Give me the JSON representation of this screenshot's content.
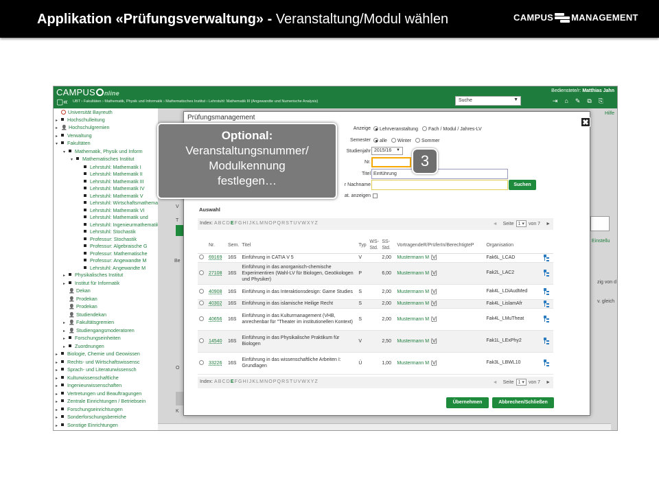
{
  "slide": {
    "title_bold": "Applikation «Prüfungsverwaltung» - ",
    "title_rest": "Veranstaltung/Modul wählen",
    "logo_text_1": "CAMPUS",
    "logo_text_2": "MANAGEMENT"
  },
  "app": {
    "logo_campus": "CAMPUS",
    "logo_online": "nline",
    "nav_icons": "▢«",
    "breadcrumb": "UBT  ›  Fakultäten  ›  Mathematik, Physik und Informatik  ›  Mathematisches Institut  ›  Lehrstuhl: Mathematik III (Angewandte und Numerische Analysis)",
    "user_label": "Bedienstete/r: ",
    "user_name": "Matthias Jahn",
    "search_select": "Suche",
    "toolbar_icons": "⇥⌂✎⧉⎘",
    "help": "Hilfe"
  },
  "tree": [
    {
      "indent": 0,
      "arrow": "",
      "kind": "uni",
      "label": "Universität Bayreuth"
    },
    {
      "indent": 0,
      "arrow": "▸",
      "kind": "sq",
      "label": "Hochschulleitung"
    },
    {
      "indent": 0,
      "arrow": "▸",
      "kind": "ppl",
      "label": "Hochschulgremien"
    },
    {
      "indent": 0,
      "arrow": "▸",
      "kind": "sq",
      "label": "Verwaltung"
    },
    {
      "indent": 0,
      "arrow": "▾",
      "kind": "sq",
      "label": "Fakultäten"
    },
    {
      "indent": 1,
      "arrow": "▾",
      "kind": "sq",
      "label": "Mathematik, Physik und Inform"
    },
    {
      "indent": 2,
      "arrow": "▾",
      "kind": "sq",
      "label": "Mathematisches Institut"
    },
    {
      "indent": 3,
      "arrow": "",
      "kind": "sq",
      "label": "Lehrstuhl: Mathematik I"
    },
    {
      "indent": 3,
      "arrow": "",
      "kind": "sq",
      "label": "Lehrstuhl: Mathematik II"
    },
    {
      "indent": 3,
      "arrow": "",
      "kind": "sq",
      "label": "Lehrstuhl: Mathematik III"
    },
    {
      "indent": 3,
      "arrow": "",
      "kind": "sq",
      "label": "Lehrstuhl: Mathematik IV"
    },
    {
      "indent": 3,
      "arrow": "",
      "kind": "sq",
      "label": "Lehrstuhl: Mathematik V"
    },
    {
      "indent": 3,
      "arrow": "",
      "kind": "sq",
      "label": "Lehrstuhl: Wirtschaftsmathematik"
    },
    {
      "indent": 3,
      "arrow": "",
      "kind": "sq",
      "label": "Lehrstuhl: Mathematik VI"
    },
    {
      "indent": 3,
      "arrow": "",
      "kind": "sq",
      "label": "Lehrstuhl: Mathematik und"
    },
    {
      "indent": 3,
      "arrow": "",
      "kind": "sq",
      "label": "Lehrstuhl: Ingenieurmathematik"
    },
    {
      "indent": 3,
      "arrow": "",
      "kind": "sq",
      "label": "Lehrstuhl: Stochastik"
    },
    {
      "indent": 3,
      "arrow": "",
      "kind": "sq",
      "label": "Professur: Stochastik"
    },
    {
      "indent": 3,
      "arrow": "",
      "kind": "sq",
      "label": "Professur: Algebraische G"
    },
    {
      "indent": 3,
      "arrow": "",
      "kind": "sq",
      "label": "Professur: Mathematische"
    },
    {
      "indent": 3,
      "arrow": "",
      "kind": "sq",
      "label": "Professur: Angewandte M"
    },
    {
      "indent": 3,
      "arrow": "",
      "kind": "sq",
      "label": "Lehrstuhl: Angewandte M"
    },
    {
      "indent": 1,
      "arrow": "▸",
      "kind": "sq",
      "label": "Physikalisches Institut"
    },
    {
      "indent": 1,
      "arrow": "▸",
      "kind": "sq",
      "label": "Institut für Informatik"
    },
    {
      "indent": 1,
      "arrow": "",
      "kind": "ppl",
      "label": "Dekan"
    },
    {
      "indent": 1,
      "arrow": "",
      "kind": "ppl",
      "label": "Prodekan"
    },
    {
      "indent": 1,
      "arrow": "",
      "kind": "ppl",
      "label": "Prodekan"
    },
    {
      "indent": 1,
      "arrow": "",
      "kind": "ppl",
      "label": "Studiendekan"
    },
    {
      "indent": 1,
      "arrow": "▸",
      "kind": "ppl",
      "label": "Fakultätsgremien"
    },
    {
      "indent": 1,
      "arrow": "▸",
      "kind": "ppl",
      "label": "Studiengangsmoderatoren"
    },
    {
      "indent": 1,
      "arrow": "▸",
      "kind": "sq",
      "label": "Forschungseinheiten"
    },
    {
      "indent": 1,
      "arrow": "▸",
      "kind": "sq",
      "label": "Zuordnungen"
    },
    {
      "indent": 0,
      "arrow": "▸",
      "kind": "sq",
      "label": "Biologie, Chemie und Geowissen"
    },
    {
      "indent": 0,
      "arrow": "▸",
      "kind": "sq",
      "label": "Rechts- und Wirtschaftswissensc"
    },
    {
      "indent": 0,
      "arrow": "▸",
      "kind": "sq",
      "label": "Sprach- und Literaturwissensch"
    },
    {
      "indent": 0,
      "arrow": "▸",
      "kind": "sq",
      "label": "Kulturwissenschaftliche"
    },
    {
      "indent": 0,
      "arrow": "▸",
      "kind": "sq",
      "label": "Ingenieurwissenschaften"
    },
    {
      "indent": 0,
      "arrow": "▸",
      "kind": "sq",
      "label": "Vertretungen und Beauftragungen"
    },
    {
      "indent": 0,
      "arrow": "▸",
      "kind": "sq",
      "label": "Zentrale Einrichtungen / Betriebsein"
    },
    {
      "indent": 0,
      "arrow": "▸",
      "kind": "sq",
      "label": "Forschungseinrichtungen"
    },
    {
      "indent": 0,
      "arrow": "▸",
      "kind": "sq",
      "label": "Sonderforschungsbereiche"
    },
    {
      "indent": 0,
      "arrow": "▸",
      "kind": "sq",
      "label": "Sonstige Einrichtungen"
    }
  ],
  "background": {
    "t1": "Einstellu",
    "t2": "zig von d",
    "t3": "v. gleich"
  },
  "modal": {
    "title": "Prüfungsmanagement",
    "close": "✖",
    "anzeige_label": "Anzeige",
    "anzeige_opt1": "Lehrveranstaltung",
    "anzeige_opt2": "Fach / Modul / Jahres-LV",
    "semester_label": "Semester",
    "semester_opt1": "alle",
    "semester_opt2": "Winter",
    "semester_opt3": "Sommer",
    "studienjahr_label": "Studienjahr",
    "studienjahr_value": "2015/16",
    "nr_label": "Nr.",
    "nr_value": "",
    "titel_label": "Titel",
    "titel_value": "Einführung",
    "nachname_label": "r Nachname",
    "nachname_value": "",
    "suchen": "Suchen",
    "stat_label": "at. anzeigen",
    "auswahl": "Auswahl",
    "index_label": "Index: ",
    "index_letters_pre": "ABCD",
    "index_letter_active": "E",
    "index_letters_post": "FGHIJKLMNOPQRSTUVWXYZ",
    "seite_label": "Seite",
    "seite_value": "1",
    "von_label": "von 7",
    "columns": [
      "Nr.",
      "Sem.",
      "Titel",
      "Typ",
      "WS-Std.",
      "SS-Std.",
      "VortragendeR/PrüferIn/BerechtigteP",
      "Organisation"
    ],
    "rows": [
      {
        "nr": "69169",
        "sem": "16S",
        "titel": "Einführung in CATIA V 5",
        "typ": "V",
        "ws": "",
        "ss": "2,00",
        "person": "Mustermann M",
        "v": "[V]",
        "org": "Fak6L_LCAD"
      },
      {
        "nr": "27108",
        "sem": "16S",
        "titel": "Einführung in das anorganisch-chemische Experimentiren (Wahl-LV für Biologen, Geoökologen und Physiker)",
        "typ": "P",
        "ws": "",
        "ss": "6,00",
        "person": "Mustermann M",
        "v": "[V]",
        "org": "Fak2L_LAC2"
      },
      {
        "nr": "40908",
        "sem": "16S",
        "titel": "Einführung in das Interaktionsdesign: Game Studies",
        "typ": "S",
        "ws": "",
        "ss": "2,00",
        "person": "Mustermann M",
        "v": "[V]",
        "org": "Fak4L_LDiAudMed"
      },
      {
        "nr": "40302",
        "sem": "16S",
        "titel": "Einführung in das islamische Heilige Recht",
        "typ": "S",
        "ws": "",
        "ss": "2,00",
        "person": "Mustermann M",
        "v": "[V]",
        "org": "Fak4L_LislamAfr"
      },
      {
        "nr": "40656",
        "sem": "16S",
        "titel": "Einführung in das Kulturmanagement (VHB, anrechenbar für \"Theater im institutionellen Kontext)",
        "typ": "S",
        "ws": "",
        "ss": "2,00",
        "person": "Mustermann M",
        "v": "[V]",
        "org": "Fak4L_LMuTheat"
      },
      {
        "nr": "14540",
        "sem": "16S",
        "titel": "Einführung in das Physikalische Praktikum für Biologen",
        "typ": "V",
        "ws": "",
        "ss": "2,50",
        "person": "Mustermann M",
        "v": "[V]",
        "org": "Fak1L_LExPhy2"
      },
      {
        "nr": "33226",
        "sem": "16S",
        "titel": "Einführung in das wissenschaftliche Arbeiten I: Grundlagen",
        "typ": "Ü",
        "ws": "",
        "ss": "1,00",
        "person": "Mustermann M",
        "v": "[V]",
        "org": "Fak3L_LBWL10"
      }
    ],
    "uebernehmen": "Übernehmen",
    "abbrechen": "Abbrechen/Schließen"
  },
  "callout": {
    "line1": "Optional:",
    "line2": "Veranstaltungsnummer/",
    "line3": "Modulkennung",
    "line4": "festlegen…"
  },
  "step_badge": "3",
  "colors": {
    "brand_green": "#1e7d3c",
    "focus_orange": "#f5a800",
    "callout_gray": "#7a7a7a"
  }
}
